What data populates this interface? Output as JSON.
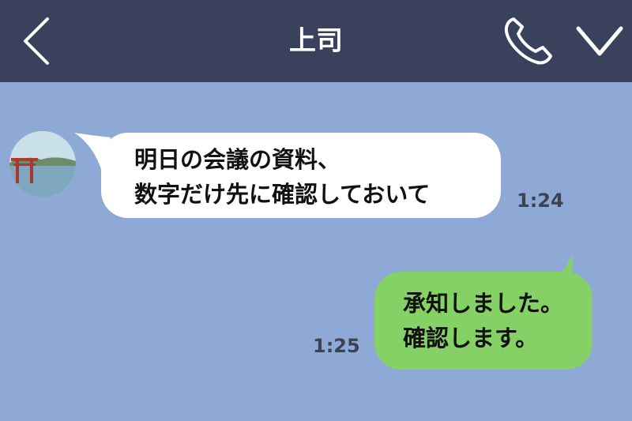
{
  "header": {
    "title": "上司",
    "back_icon": "chevron-left-icon",
    "call_icon": "phone-icon",
    "menu_icon": "chevron-down-icon"
  },
  "colors": {
    "header_bg": "#3a415c",
    "chat_bg": "#8fa9d6",
    "incoming_bubble": "#ffffff",
    "outgoing_bubble": "#86d165"
  },
  "messages": [
    {
      "direction": "incoming",
      "lines": [
        "明日の会議の資料、",
        "数字だけ先に確認しておいて"
      ],
      "time": "1:24"
    },
    {
      "direction": "outgoing",
      "lines": [
        "承知しました。",
        "確認します。"
      ],
      "time": "1:25"
    }
  ]
}
